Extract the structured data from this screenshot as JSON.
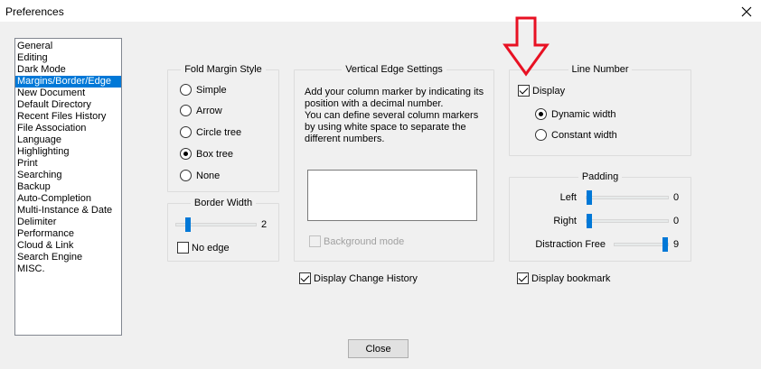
{
  "window": {
    "title": "Preferences",
    "close_icon": "×"
  },
  "sidebar": {
    "items": [
      {
        "label": "General"
      },
      {
        "label": "Editing"
      },
      {
        "label": "Dark Mode"
      },
      {
        "label": "Margins/Border/Edge",
        "selected": true
      },
      {
        "label": "New Document"
      },
      {
        "label": "Default Directory"
      },
      {
        "label": "Recent Files History"
      },
      {
        "label": "File Association"
      },
      {
        "label": "Language"
      },
      {
        "label": "Highlighting"
      },
      {
        "label": "Print"
      },
      {
        "label": "Searching"
      },
      {
        "label": "Backup"
      },
      {
        "label": "Auto-Completion"
      },
      {
        "label": "Multi-Instance & Date"
      },
      {
        "label": "Delimiter"
      },
      {
        "label": "Performance"
      },
      {
        "label": "Cloud & Link"
      },
      {
        "label": "Search Engine"
      },
      {
        "label": "MISC."
      }
    ]
  },
  "fold_margin": {
    "title": "Fold Margin Style",
    "options": [
      {
        "label": "Simple",
        "checked": false
      },
      {
        "label": "Arrow",
        "checked": false
      },
      {
        "label": "Circle tree",
        "checked": false
      },
      {
        "label": "Box tree",
        "checked": true
      },
      {
        "label": "None",
        "checked": false
      }
    ]
  },
  "border_width": {
    "title": "Border Width",
    "value": "2",
    "level": 0.13,
    "no_edge_label": "No edge",
    "no_edge_checked": false
  },
  "vertical_edge": {
    "title": "Vertical Edge Settings",
    "description": "Add your column marker by indicating its position with a decimal number.\nYou can define several column markers by using white space to separate the different numbers.",
    "background_mode_label": "Background mode",
    "background_mode_checked": false
  },
  "display_change_history": {
    "label": "Display Change History",
    "checked": true
  },
  "line_number": {
    "title": "Line Number",
    "display_label": "Display",
    "display_checked": true,
    "options": [
      {
        "label": "Dynamic width",
        "checked": true
      },
      {
        "label": "Constant width",
        "checked": false
      }
    ]
  },
  "padding": {
    "title": "Padding",
    "left": {
      "label": "Left",
      "value": "0",
      "level": 0.0
    },
    "right": {
      "label": "Right",
      "value": "0",
      "level": 0.0
    },
    "distraction_free": {
      "label": "Distraction Free",
      "value": "9",
      "level": 1.0
    }
  },
  "display_bookmark": {
    "label": "Display bookmark",
    "checked": true
  },
  "close_button": {
    "label": "Close"
  },
  "colors": {
    "selection": "#0078d7",
    "annotation_arrow": "#e81123"
  }
}
